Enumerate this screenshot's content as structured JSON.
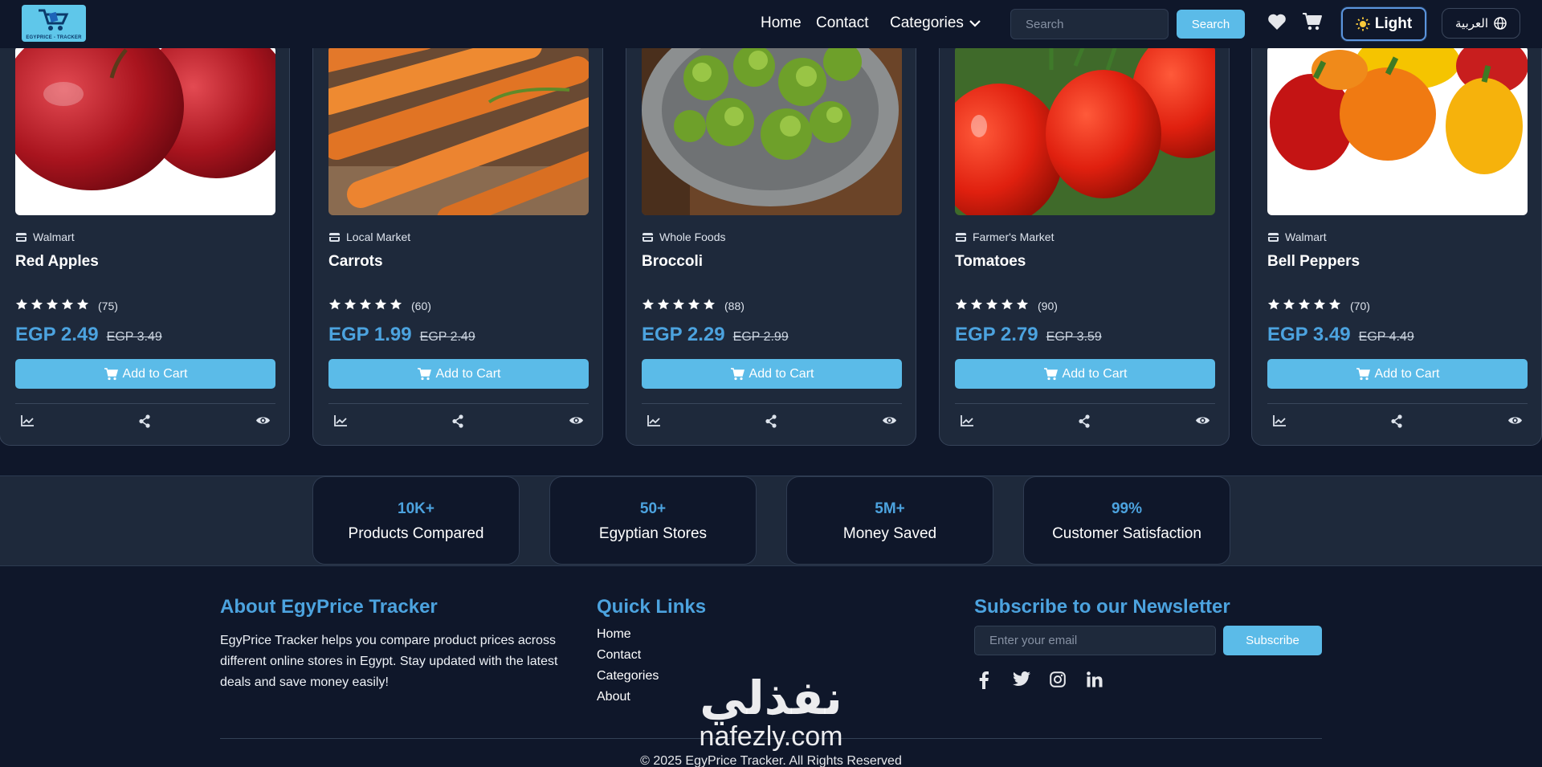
{
  "navbar": {
    "logo_text": "EGYPRICE - TRACKER",
    "links": {
      "home": "Home",
      "contact": "Contact",
      "categories": "Categories"
    },
    "search": {
      "placeholder": "Search",
      "button_label": "Search"
    },
    "theme_label": "Light",
    "language_label": "العربية",
    "icons": [
      "heart-icon",
      "cart-icon",
      "sun-icon",
      "globe-icon",
      "chevron-down-icon"
    ]
  },
  "products": [
    {
      "store": "Walmart",
      "name": "Red Apples",
      "rating": 5,
      "reviews": "(75)",
      "price": "EGP 2.49",
      "old_price": "EGP 3.49",
      "button": "Add to Cart"
    },
    {
      "store": "Local Market",
      "name": "Carrots",
      "rating": 5,
      "reviews": "(60)",
      "price": "EGP 1.99",
      "old_price": "EGP 2.49",
      "button": "Add to Cart"
    },
    {
      "store": "Whole Foods",
      "name": "Broccoli",
      "rating": 5,
      "reviews": "(88)",
      "price": "EGP 2.29",
      "old_price": "EGP 2.99",
      "button": "Add to Cart"
    },
    {
      "store": "Farmer's Market",
      "name": "Tomatoes",
      "rating": 5,
      "reviews": "(90)",
      "price": "EGP 2.79",
      "old_price": "EGP 3.59",
      "button": "Add to Cart"
    },
    {
      "store": "Walmart",
      "name": "Bell Peppers",
      "rating": 5,
      "reviews": "(70)",
      "price": "EGP 3.49",
      "old_price": "EGP 4.49",
      "button": "Add to Cart"
    }
  ],
  "stats": [
    {
      "value": "10K+",
      "label": "Products Compared"
    },
    {
      "value": "50+",
      "label": "Egyptian Stores"
    },
    {
      "value": "5M+",
      "label": "Money Saved"
    },
    {
      "value": "99%",
      "label": "Customer Satisfaction"
    }
  ],
  "footer": {
    "about": {
      "title": "About EgyPrice Tracker",
      "text": "EgyPrice Tracker helps you compare product prices across different online stores in Egypt. Stay updated with the latest deals and save money easily!"
    },
    "quick_links": {
      "title": "Quick Links",
      "items": [
        "Home",
        "Contact",
        "Categories",
        "About"
      ]
    },
    "newsletter": {
      "title": "Subscribe to our Newsletter",
      "placeholder": "Enter your email",
      "button": "Subscribe",
      "social": [
        "facebook-icon",
        "twitter-icon",
        "instagram-icon",
        "linkedin-icon"
      ]
    },
    "copyright": "© 2025 EgyPrice Tracker. All Rights Reserved"
  },
  "watermark": {
    "arabic": "نفذلي",
    "latin": "nafezly.com"
  },
  "colors": {
    "background": "#0f172a",
    "card": "#1e293b",
    "accent": "#4ca3df",
    "button": "#5bbbe8"
  }
}
